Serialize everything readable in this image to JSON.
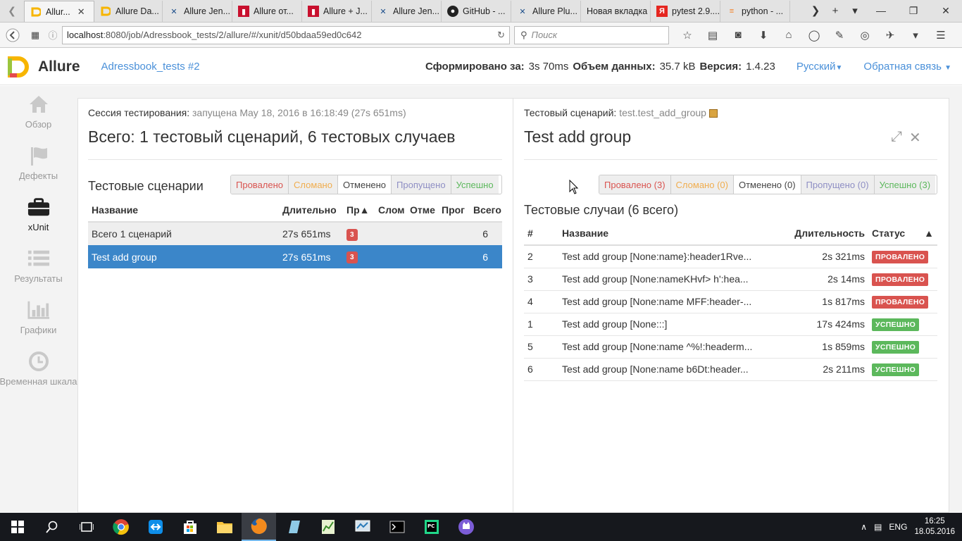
{
  "browser": {
    "tabs": [
      {
        "label": "Allur...",
        "active": true,
        "favicon": "allure-icon"
      },
      {
        "label": "Allure Da...",
        "favicon": "allure-icon"
      },
      {
        "label": "Allure Jen...",
        "favicon": "jenkins-icon"
      },
      {
        "label": "Allure от...",
        "favicon": "bookmark-red-icon"
      },
      {
        "label": "Allure + J...",
        "favicon": "bookmark-red-icon"
      },
      {
        "label": "Allure Jen...",
        "favicon": "jenkins-icon"
      },
      {
        "label": "GitHub - ...",
        "favicon": "github-icon"
      },
      {
        "label": "Allure Plu...",
        "favicon": "jenkins-icon"
      },
      {
        "label": "Новая вкладка",
        "favicon": ""
      },
      {
        "label": "pytest 2.9....",
        "favicon": "yandex-icon"
      },
      {
        "label": "python - ...",
        "favicon": "stackoverflow-icon"
      }
    ],
    "url_host": "localhost",
    "url_path": ":8080/job/Adressbook_tests/2/allure/#/xunit/d50bdaa59ed0c642",
    "search_placeholder": "Поиск"
  },
  "header": {
    "brand": "Allure",
    "report_link": "Adressbook_tests #2",
    "generated_label": "Сформировано за:",
    "generated_value": "3s 70ms",
    "size_label": "Объем данных:",
    "size_value": "35.7 kB",
    "version_label": "Версия:",
    "version_value": "1.4.23",
    "language": "Русский",
    "feedback": "Обратная связь"
  },
  "sidebar": {
    "items": [
      {
        "label": "Обзор",
        "icon": "home-icon"
      },
      {
        "label": "Дефекты",
        "icon": "flag-icon"
      },
      {
        "label": "xUnit",
        "icon": "briefcase-icon",
        "active": true
      },
      {
        "label": "Результаты",
        "icon": "list-icon"
      },
      {
        "label": "Графики",
        "icon": "bar-chart-icon"
      },
      {
        "label": "Временная шкала",
        "icon": "clock-icon"
      }
    ]
  },
  "left": {
    "session_label": "Сессия тестирования:",
    "session_value": "запущена May 18, 2016 в 16:18:49 (27s 651ms)",
    "title": "Всего: 1 тестовый сценарий, 6 тестовых случаев",
    "section_title": "Тестовые сценарии",
    "filters": [
      "Провалено",
      "Сломано",
      "Отменено",
      "Пропущено",
      "Успешно"
    ],
    "columns": [
      "Название",
      "Длительно",
      "Пр▲",
      "Слом",
      "Отме",
      "Прог",
      "Всего"
    ],
    "rows": [
      {
        "name": "Всего 1 сценарий",
        "duration": "27s 651ms",
        "failed": "3",
        "total": "6"
      },
      {
        "name": "Test add group",
        "duration": "27s 651ms",
        "failed": "3",
        "total": "6"
      }
    ]
  },
  "right": {
    "scenario_label": "Тестовый сценарий:",
    "scenario_value": "test.test_add_group",
    "title": "Test add group",
    "filters": [
      "Провалено (3)",
      "Сломано (0)",
      "Отменено (0)",
      "Пропущено (0)",
      "Успешно (3)"
    ],
    "section_title": "Тестовые случаи (6 всего)",
    "columns": [
      "#",
      "Название",
      "Длительность",
      "Статус",
      "▲"
    ],
    "cases": [
      {
        "num": "2",
        "name": "Test add group [None:name}:header1Rve...",
        "duration": "2s 321ms",
        "status": "ПРОВАЛЕНО",
        "kind": "failed"
      },
      {
        "num": "3",
        "name": "Test add group [None:nameKHvf> h':hea...",
        "duration": "2s 14ms",
        "status": "ПРОВАЛЕНО",
        "kind": "failed"
      },
      {
        "num": "4",
        "name": "Test add group [None:name MFF:header-...",
        "duration": "1s 817ms",
        "status": "ПРОВАЛЕНО",
        "kind": "failed"
      },
      {
        "num": "1",
        "name": "Test add group [None:::]",
        "duration": "17s 424ms",
        "status": "УСПЕШНО",
        "kind": "passed"
      },
      {
        "num": "5",
        "name": "Test add group [None:name ^%!:headerm...",
        "duration": "1s 859ms",
        "status": "УСПЕШНО",
        "kind": "passed"
      },
      {
        "num": "6",
        "name": "Test add group [None:name b6Dt:header...",
        "duration": "2s 211ms",
        "status": "УСПЕШНО",
        "kind": "passed"
      }
    ]
  },
  "taskbar": {
    "lang": "ENG",
    "time": "16:25",
    "date": "18.05.2016"
  },
  "colors": {
    "accent": "#4a90d9",
    "selected_row": "#3b86c9",
    "failed": "#d9534f",
    "passed": "#5cb85c",
    "broken": "#f0ad4e"
  }
}
